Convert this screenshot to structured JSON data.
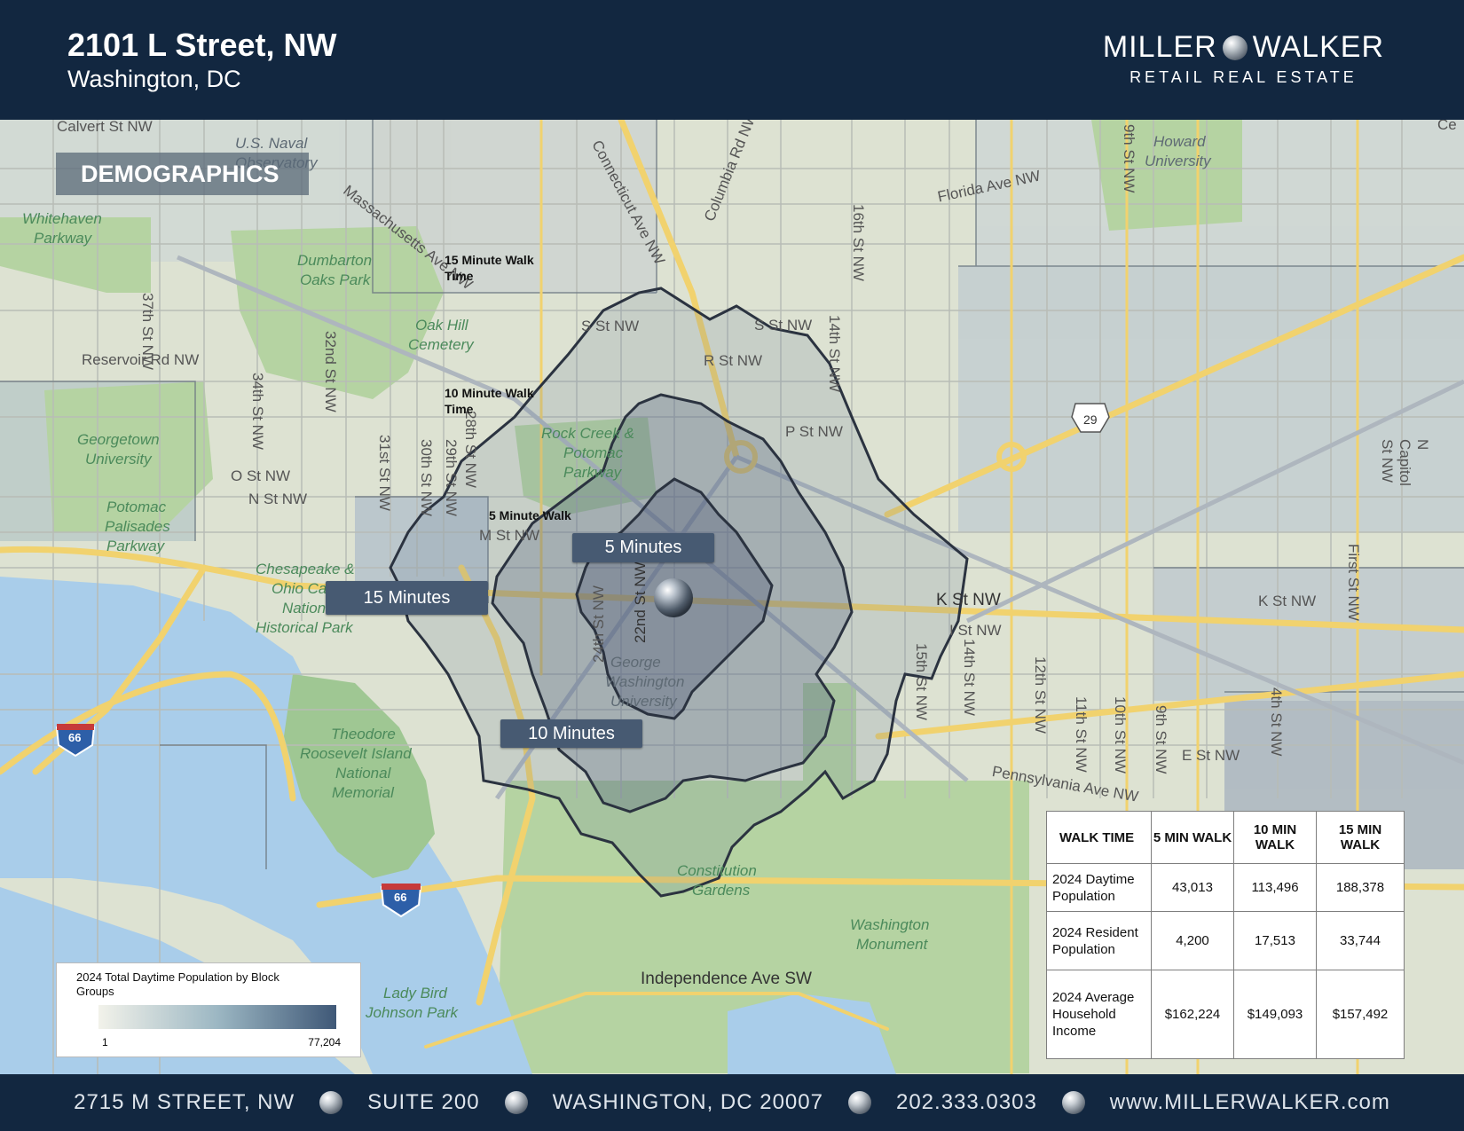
{
  "header": {
    "address": "2101 L Street, NW",
    "city": "Washington, DC",
    "brand_left": "MILLER",
    "brand_right": "WALKER",
    "tagline": "RETAIL REAL ESTATE"
  },
  "section_tag": "DEMOGRAPHICS",
  "walk_labels": {
    "five": "5 Minutes",
    "ten": "10 Minutes",
    "fifteen": "15 Minutes"
  },
  "annotations": {
    "fifteen_line1": "15 Minute Walk",
    "fifteen_line2": "Time",
    "ten_line1": "10 Minute Walk",
    "ten_line2": "Time",
    "five": "5 Minute Walk"
  },
  "map_labels": {
    "calvert": "Calvert St NW",
    "naval1": "U.S. Naval",
    "naval2": "Observatory",
    "massachusetts": "Massachusetts Ave NW",
    "connecticut": "Connecticut Ave NW",
    "columbia": "Columbia Rd NW",
    "howard1": "Howard",
    "howard2": "University",
    "florida": "Florida Ave NW",
    "whitehaven1": "Whitehaven",
    "whitehaven2": "Parkway",
    "dumbarton1": "Dumbarton",
    "dumbarton2": "Oaks Park",
    "oakhill1": "Oak Hill",
    "oakhill2": "Cemetery",
    "reservoir": "Reservoir Rd NW",
    "s_st_w": "S St NW",
    "s_st_e": "S St NW",
    "r_st": "R St NW",
    "p_st": "P St NW",
    "georgetown1": "Georgetown",
    "georgetown2": "University",
    "rockcreek1": "Rock Creek &",
    "rockcreek2": "Potomac",
    "rockcreek3": "Parkway",
    "o_st": "O St NW",
    "n_st": "N St NW",
    "m_st": "M St NW",
    "k_st": "K St NW",
    "k_st_e": "K St NW",
    "i_st": "I St NW",
    "e_st": "E St NW",
    "potomac1": "Potomac",
    "potomac2": "Palisades",
    "potomac3": "Parkway",
    "chesapeake1": "Chesapeake &",
    "chesapeake2": "Ohio Canal",
    "chesapeake3": "National",
    "chesapeake4": "Historical Park",
    "gw1": "George",
    "gw2": "Washington",
    "gw3": "University",
    "theodore1": "Theodore",
    "theodore2": "Roosevelt Island",
    "theodore3": "National",
    "theodore4": "Memorial",
    "constitution1": "Constitution",
    "constitution2": "Gardens",
    "monument1": "Washington",
    "monument2": "Monument",
    "independence": "Independence Ave SW",
    "ladybird1": "Lady Bird",
    "ladybird2": "Johnson Park",
    "pennsylvania": "Pennsylvania Ave NW",
    "st37": "37th St NW",
    "st34": "34th St NW",
    "st32": "32nd St NW",
    "st31": "31st St NW",
    "st30": "30th St NW",
    "st29": "29th St NW",
    "st28": "28th St NW",
    "st24": "24th St NW",
    "st22": "22nd St NW",
    "st16": "16th St NW",
    "st14": "14th St NW",
    "st15": "15th St NW",
    "st14s": "14th St NW",
    "st12": "12th St NW",
    "st11": "11th St NW",
    "st10": "10th St NW",
    "st9": "9th St NW",
    "st9n": "9th St NW",
    "st4": "4th St NW",
    "first": "First St NW",
    "ncapitol": "N Capitol St NW",
    "us29": "29",
    "i66a": "66",
    "i66b": "66",
    "corner": "Ce"
  },
  "legend": {
    "title": "2024 Total Daytime Population by Block Groups",
    "min": "1",
    "max": "77,204"
  },
  "table": {
    "headers": [
      "WALK TIME",
      "5 MIN WALK",
      "10 MIN WALK",
      "15 MIN WALK"
    ],
    "rows": [
      {
        "label": "2024 Daytime Population",
        "values": [
          "43,013",
          "113,496",
          "188,378"
        ]
      },
      {
        "label": "2024 Resident Population",
        "values": [
          "4,200",
          "17,513",
          "33,744"
        ]
      },
      {
        "label": "2024 Average Household Income",
        "values": [
          "$162,224",
          "$149,093",
          "$157,492"
        ]
      }
    ]
  },
  "footer": {
    "street": "2715 M STREET, NW",
    "suite": "SUITE 200",
    "city": "WASHINGTON, DC 20007",
    "phone": "202.333.0303",
    "web": "www.MILLERWALKER.com"
  },
  "colors": {
    "navy": "#122740",
    "label_bg": "#475a72",
    "water": "#a9cdea",
    "park": "#b7d4a6",
    "road_yellow": "#f1d26e"
  }
}
